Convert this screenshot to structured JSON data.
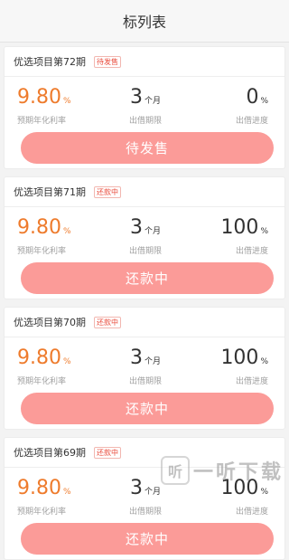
{
  "header": {
    "title": "标列表"
  },
  "cards": [
    {
      "title": "优选项目第72期",
      "status": "待发售",
      "rate": "9.80",
      "rate_unit": "%",
      "rate_label": "预期年化利率",
      "term": "3",
      "term_unit": "个月",
      "term_label": "出借期限",
      "progress": "0",
      "progress_unit": "%",
      "progress_label": "出借进度",
      "button": "待发售"
    },
    {
      "title": "优选项目第71期",
      "status": "还款中",
      "rate": "9.80",
      "rate_unit": "%",
      "rate_label": "预期年化利率",
      "term": "3",
      "term_unit": "个月",
      "term_label": "出借期限",
      "progress": "100",
      "progress_unit": "%",
      "progress_label": "出借进度",
      "button": "还款中"
    },
    {
      "title": "优选项目第70期",
      "status": "还款中",
      "rate": "9.80",
      "rate_unit": "%",
      "rate_label": "预期年化利率",
      "term": "3",
      "term_unit": "个月",
      "term_label": "出借期限",
      "progress": "100",
      "progress_unit": "%",
      "progress_label": "出借进度",
      "button": "还款中"
    },
    {
      "title": "优选项目第69期",
      "status": "还款中",
      "rate": "9.80",
      "rate_unit": "%",
      "rate_label": "预期年化利率",
      "term": "3",
      "term_unit": "个月",
      "term_label": "出借期限",
      "progress": "100",
      "progress_unit": "%",
      "progress_label": "出借进度",
      "button": "还款中"
    }
  ],
  "watermark": {
    "icon": "听",
    "text": "一听下载"
  }
}
